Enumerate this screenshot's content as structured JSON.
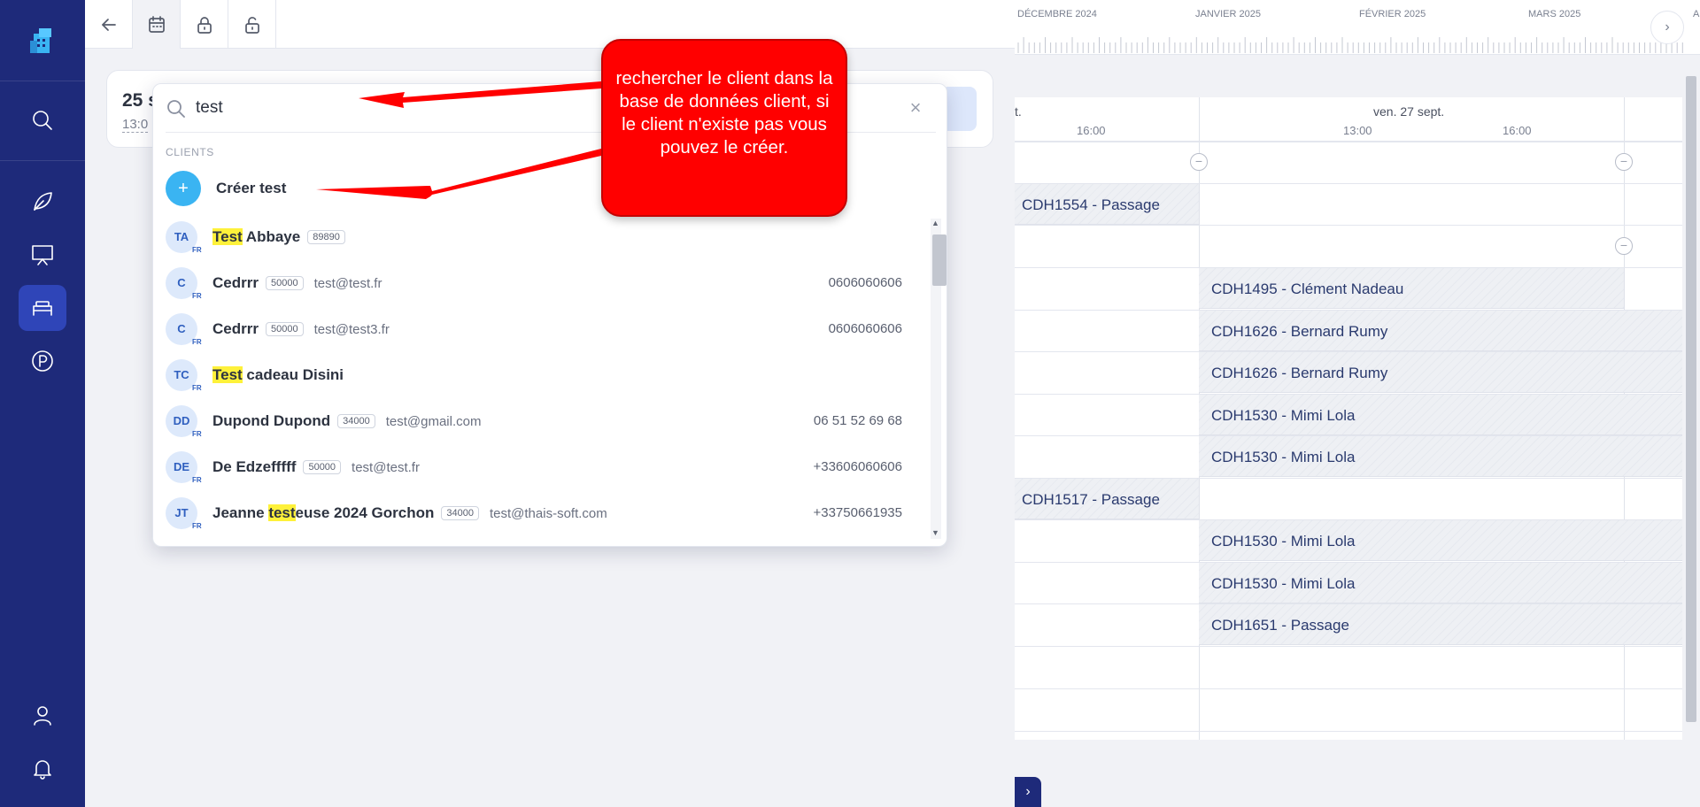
{
  "nav": {
    "items": [
      {
        "name": "search",
        "icon": "search-icon"
      },
      {
        "name": "activities",
        "icon": "leaf-icon"
      },
      {
        "name": "presentation",
        "icon": "board-icon"
      },
      {
        "name": "accommodation",
        "icon": "bed-icon",
        "active": true
      },
      {
        "name": "parking",
        "icon": "parking-icon"
      },
      {
        "name": "profile",
        "icon": "user-icon"
      },
      {
        "name": "notifications",
        "icon": "bell-icon"
      }
    ]
  },
  "toolbar": {
    "buttons": [
      "back-arrow-icon",
      "calendar-icon",
      "lock-icon",
      "unlock-icon"
    ]
  },
  "reservation": {
    "date": "25 s",
    "time": "13:0"
  },
  "search": {
    "value": "test",
    "clear": "×",
    "section": "CLIENTS",
    "create": {
      "plus": "+",
      "label": "Créer test"
    },
    "results": [
      {
        "initials": "TA",
        "flag": "FR",
        "name_hl": "Test",
        "name_rest": " Abbaye",
        "zip": "89890",
        "email": "",
        "phone": ""
      },
      {
        "initials": "C",
        "flag": "FR",
        "name_hl": "",
        "name_rest": "Cedrrr",
        "zip": "50000",
        "email": "test@test.fr",
        "phone": "0606060606"
      },
      {
        "initials": "C",
        "flag": "FR",
        "name_hl": "",
        "name_rest": "Cedrrr",
        "zip": "50000",
        "email": "test@test3.fr",
        "phone": "0606060606"
      },
      {
        "initials": "TC",
        "flag": "FR",
        "name_hl": "Test",
        "name_rest": " cadeau Disini",
        "zip": "",
        "email": "",
        "phone": ""
      },
      {
        "initials": "DD",
        "flag": "FR",
        "name_hl": "",
        "name_rest": "Dupond Dupond",
        "zip": "34000",
        "email": "test@gmail.com",
        "phone": "06 51 52 69 68"
      },
      {
        "initials": "DE",
        "flag": "FR",
        "name_hl": "",
        "name_rest": "De Edzefffff",
        "zip": "50000",
        "email": "test@test.fr",
        "phone": "+33606060606"
      },
      {
        "initials": "JT",
        "flag": "FR",
        "name_pre": "Jeanne ",
        "name_hl": "test",
        "name_rest": "euse 2024 Gorchon",
        "zip": "34000",
        "email": "test@thais-soft.com",
        "phone": "+33750661935"
      }
    ]
  },
  "annotation": {
    "text": "rechercher le client dans la base de données client, si le client n'existe pas vous pouvez le créer.",
    "color": "#ff0000"
  },
  "timeline": {
    "months": [
      "DÉCEMBRE 2024",
      "JANVIER 2025",
      "FÉVRIER 2025",
      "MARS 2025",
      "A"
    ],
    "day_prev_fragment": "t.",
    "day": "ven. 27 sept.",
    "hours": [
      "16:00",
      "13:00",
      "16:00"
    ],
    "reservations": [
      {
        "label": "CDH1554 - Passage",
        "col": "prev"
      },
      {
        "label": "CDH1495 - Clément Nadeau",
        "col": "day"
      },
      {
        "label": "CDH1626 - Bernard Rumy",
        "col": "day"
      },
      {
        "label": "CDH1626 - Bernard Rumy",
        "col": "day"
      },
      {
        "label": "CDH1530 - Mimi Lola",
        "col": "day"
      },
      {
        "label": "CDH1530 - Mimi Lola",
        "col": "day"
      },
      {
        "label": "CDH1517 - Passage",
        "col": "prev"
      },
      {
        "label": "CDH1530 - Mimi Lola",
        "col": "day"
      },
      {
        "label": "CDH1530 - Mimi Lola",
        "col": "day"
      },
      {
        "label": "CDH1651 - Passage",
        "col": "day"
      }
    ],
    "next": "›",
    "collapse": "›"
  },
  "colors": {
    "nav": "#1e2a7a",
    "nav_active": "#2f45b8",
    "create_button": "#3ab4f2",
    "highlight": "#fef13a"
  }
}
